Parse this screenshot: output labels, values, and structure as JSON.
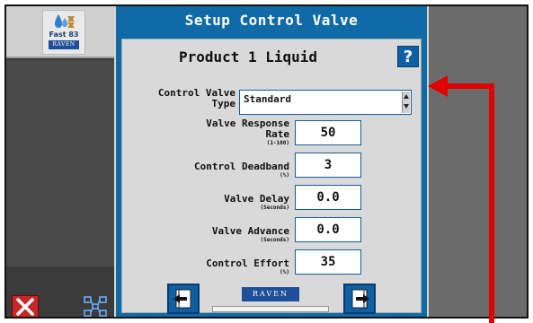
{
  "logo": {
    "text": "Fast 83",
    "brand": "RAVEN"
  },
  "dialog": {
    "title": "Setup Control Valve",
    "product": "Product 1 Liquid",
    "help_label": "?"
  },
  "fields": {
    "control_valve_type": {
      "label_line1": "Control Valve",
      "label_line2": "Type",
      "value": "Standard"
    },
    "valve_response_rate": {
      "label_line1": "Valve Response",
      "label_line2": "Rate",
      "unit": "(1-100)",
      "value": "50"
    },
    "control_deadband": {
      "label": "Control Deadband",
      "unit": "(%)",
      "value": "3"
    },
    "valve_delay": {
      "label": "Valve Delay",
      "unit": "(Seconds)",
      "value": "0.0"
    },
    "valve_advance": {
      "label": "Valve Advance",
      "unit": "(Seconds)",
      "value": "0.0"
    },
    "control_effort": {
      "label": "Control Effort",
      "unit": "(%)",
      "value": "35"
    }
  },
  "footer": {
    "brand": "RAVEN",
    "progress_fraction": 0.0
  },
  "icons": {
    "help": "question-mark-icon",
    "close": "close-icon",
    "network": "network-icon",
    "back": "previous-page-icon",
    "forward": "next-page-icon",
    "logo": "water-drop-icon"
  },
  "colors": {
    "title_bar": "#0f6aa6",
    "panel": "#d9d9d9",
    "close": "#c62828",
    "annotation_arrow": "#e00000",
    "raven_blue": "#1f4f99"
  }
}
